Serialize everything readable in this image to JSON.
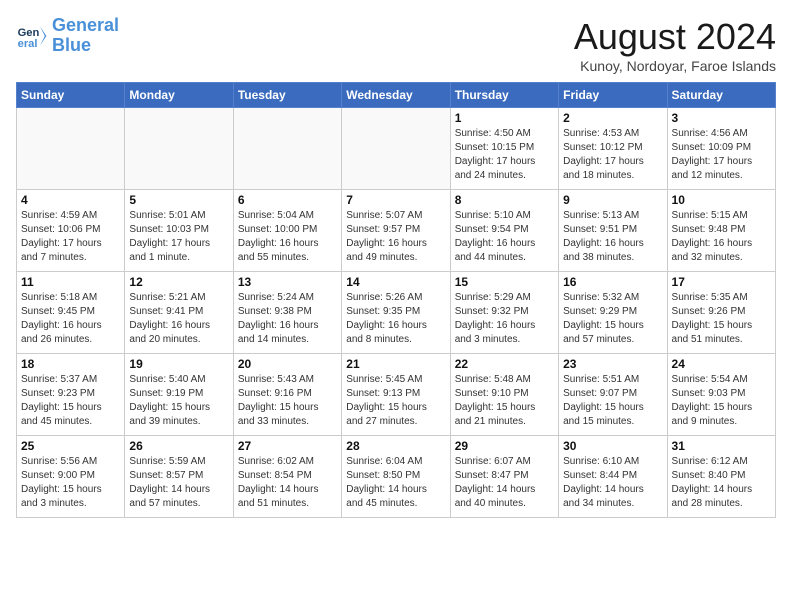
{
  "header": {
    "title": "August 2024",
    "subtitle": "Kunoy, Nordoyar, Faroe Islands",
    "logo_line1": "General",
    "logo_line2": "Blue"
  },
  "weekdays": [
    "Sunday",
    "Monday",
    "Tuesday",
    "Wednesday",
    "Thursday",
    "Friday",
    "Saturday"
  ],
  "weeks": [
    [
      {
        "day": "",
        "info": ""
      },
      {
        "day": "",
        "info": ""
      },
      {
        "day": "",
        "info": ""
      },
      {
        "day": "",
        "info": ""
      },
      {
        "day": "1",
        "info": "Sunrise: 4:50 AM\nSunset: 10:15 PM\nDaylight: 17 hours\nand 24 minutes."
      },
      {
        "day": "2",
        "info": "Sunrise: 4:53 AM\nSunset: 10:12 PM\nDaylight: 17 hours\nand 18 minutes."
      },
      {
        "day": "3",
        "info": "Sunrise: 4:56 AM\nSunset: 10:09 PM\nDaylight: 17 hours\nand 12 minutes."
      }
    ],
    [
      {
        "day": "4",
        "info": "Sunrise: 4:59 AM\nSunset: 10:06 PM\nDaylight: 17 hours\nand 7 minutes."
      },
      {
        "day": "5",
        "info": "Sunrise: 5:01 AM\nSunset: 10:03 PM\nDaylight: 17 hours\nand 1 minute."
      },
      {
        "day": "6",
        "info": "Sunrise: 5:04 AM\nSunset: 10:00 PM\nDaylight: 16 hours\nand 55 minutes."
      },
      {
        "day": "7",
        "info": "Sunrise: 5:07 AM\nSunset: 9:57 PM\nDaylight: 16 hours\nand 49 minutes."
      },
      {
        "day": "8",
        "info": "Sunrise: 5:10 AM\nSunset: 9:54 PM\nDaylight: 16 hours\nand 44 minutes."
      },
      {
        "day": "9",
        "info": "Sunrise: 5:13 AM\nSunset: 9:51 PM\nDaylight: 16 hours\nand 38 minutes."
      },
      {
        "day": "10",
        "info": "Sunrise: 5:15 AM\nSunset: 9:48 PM\nDaylight: 16 hours\nand 32 minutes."
      }
    ],
    [
      {
        "day": "11",
        "info": "Sunrise: 5:18 AM\nSunset: 9:45 PM\nDaylight: 16 hours\nand 26 minutes."
      },
      {
        "day": "12",
        "info": "Sunrise: 5:21 AM\nSunset: 9:41 PM\nDaylight: 16 hours\nand 20 minutes."
      },
      {
        "day": "13",
        "info": "Sunrise: 5:24 AM\nSunset: 9:38 PM\nDaylight: 16 hours\nand 14 minutes."
      },
      {
        "day": "14",
        "info": "Sunrise: 5:26 AM\nSunset: 9:35 PM\nDaylight: 16 hours\nand 8 minutes."
      },
      {
        "day": "15",
        "info": "Sunrise: 5:29 AM\nSunset: 9:32 PM\nDaylight: 16 hours\nand 3 minutes."
      },
      {
        "day": "16",
        "info": "Sunrise: 5:32 AM\nSunset: 9:29 PM\nDaylight: 15 hours\nand 57 minutes."
      },
      {
        "day": "17",
        "info": "Sunrise: 5:35 AM\nSunset: 9:26 PM\nDaylight: 15 hours\nand 51 minutes."
      }
    ],
    [
      {
        "day": "18",
        "info": "Sunrise: 5:37 AM\nSunset: 9:23 PM\nDaylight: 15 hours\nand 45 minutes."
      },
      {
        "day": "19",
        "info": "Sunrise: 5:40 AM\nSunset: 9:19 PM\nDaylight: 15 hours\nand 39 minutes."
      },
      {
        "day": "20",
        "info": "Sunrise: 5:43 AM\nSunset: 9:16 PM\nDaylight: 15 hours\nand 33 minutes."
      },
      {
        "day": "21",
        "info": "Sunrise: 5:45 AM\nSunset: 9:13 PM\nDaylight: 15 hours\nand 27 minutes."
      },
      {
        "day": "22",
        "info": "Sunrise: 5:48 AM\nSunset: 9:10 PM\nDaylight: 15 hours\nand 21 minutes."
      },
      {
        "day": "23",
        "info": "Sunrise: 5:51 AM\nSunset: 9:07 PM\nDaylight: 15 hours\nand 15 minutes."
      },
      {
        "day": "24",
        "info": "Sunrise: 5:54 AM\nSunset: 9:03 PM\nDaylight: 15 hours\nand 9 minutes."
      }
    ],
    [
      {
        "day": "25",
        "info": "Sunrise: 5:56 AM\nSunset: 9:00 PM\nDaylight: 15 hours\nand 3 minutes."
      },
      {
        "day": "26",
        "info": "Sunrise: 5:59 AM\nSunset: 8:57 PM\nDaylight: 14 hours\nand 57 minutes."
      },
      {
        "day": "27",
        "info": "Sunrise: 6:02 AM\nSunset: 8:54 PM\nDaylight: 14 hours\nand 51 minutes."
      },
      {
        "day": "28",
        "info": "Sunrise: 6:04 AM\nSunset: 8:50 PM\nDaylight: 14 hours\nand 45 minutes."
      },
      {
        "day": "29",
        "info": "Sunrise: 6:07 AM\nSunset: 8:47 PM\nDaylight: 14 hours\nand 40 minutes."
      },
      {
        "day": "30",
        "info": "Sunrise: 6:10 AM\nSunset: 8:44 PM\nDaylight: 14 hours\nand 34 minutes."
      },
      {
        "day": "31",
        "info": "Sunrise: 6:12 AM\nSunset: 8:40 PM\nDaylight: 14 hours\nand 28 minutes."
      }
    ]
  ]
}
